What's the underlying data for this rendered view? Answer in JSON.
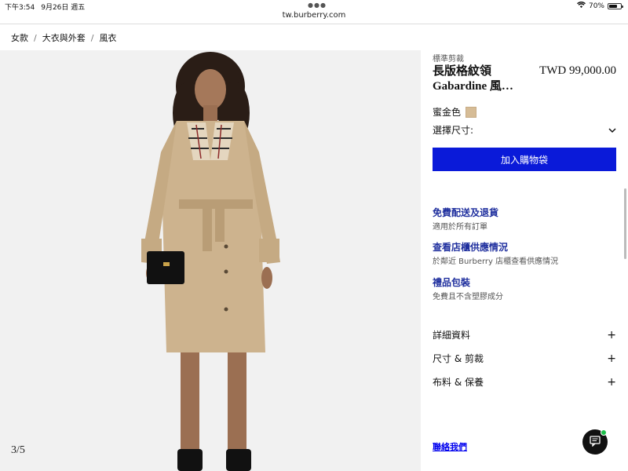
{
  "status_bar": {
    "time": "下午3:54",
    "date": "9月26日 週五",
    "battery_pct": "70%",
    "battery_level": 0.7
  },
  "url": "tw.burberry.com",
  "breadcrumb": [
    "女款",
    "大衣與外套",
    "風衣"
  ],
  "image": {
    "counter": "3/5",
    "alt": "trench-coat-model"
  },
  "product": {
    "fit_label": "標準剪裁",
    "name": "長版格紋領 Gabardine 風…",
    "price": "TWD 99,000.00",
    "color_name": "蜜金色",
    "color_swatch": "#d6bc96",
    "size_label": "選擇尺寸:",
    "add_to_bag": "加入購物袋"
  },
  "services": [
    {
      "title": "免費配送及退貨",
      "subtitle": "適用於所有訂單"
    },
    {
      "title": "查看店櫃供應情況",
      "subtitle": "於鄰近 Burberry 店櫃查看供應情況"
    },
    {
      "title": "禮品包裝",
      "subtitle": "免費且不含塑膠成分"
    }
  ],
  "accordion": [
    "詳細資料",
    "尺寸 & 剪裁",
    "布料 & 保養"
  ],
  "contact_label": "聯絡我們",
  "colors": {
    "accent_button": "#0a1ad9",
    "link_blue": "#1f2f9e",
    "chat_online": "#1dbf4a"
  }
}
